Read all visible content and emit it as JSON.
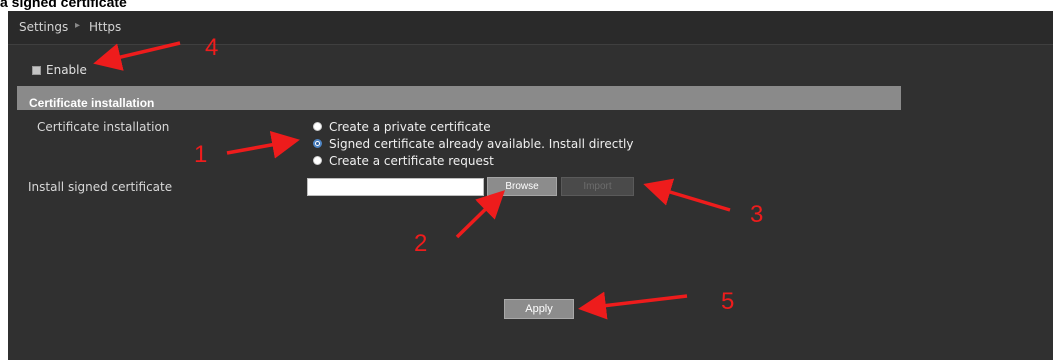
{
  "document": {
    "caption": "a signed certificate"
  },
  "breadcrumb": {
    "root": "Settings",
    "separator": "▸",
    "current": "Https"
  },
  "enable": {
    "label": "Enable",
    "checked": true
  },
  "section": {
    "title": "Certificate installation"
  },
  "certificate_installation": {
    "label": "Certificate installation",
    "options": [
      {
        "label": "Create a private certificate",
        "selected": false
      },
      {
        "label": "Signed certificate already available. Install directly",
        "selected": true
      },
      {
        "label": "Create a certificate request",
        "selected": false
      }
    ]
  },
  "install": {
    "label": "Install signed certificate",
    "file_value": "",
    "browse_label": "Browse",
    "import_label": "Import",
    "import_enabled": false
  },
  "apply_label": "Apply",
  "annotations": [
    {
      "number": "1",
      "target": "option-signed-certificate"
    },
    {
      "number": "2",
      "target": "browse-button"
    },
    {
      "number": "3",
      "target": "import-button"
    },
    {
      "number": "4",
      "target": "enable-checkbox"
    },
    {
      "number": "5",
      "target": "apply-button"
    }
  ],
  "colors": {
    "panel_bg": "#303030",
    "section_header_bg": "#8a8a8a",
    "annotation_red": "#ee1c1c",
    "selected_radio": "#4f86c6"
  }
}
